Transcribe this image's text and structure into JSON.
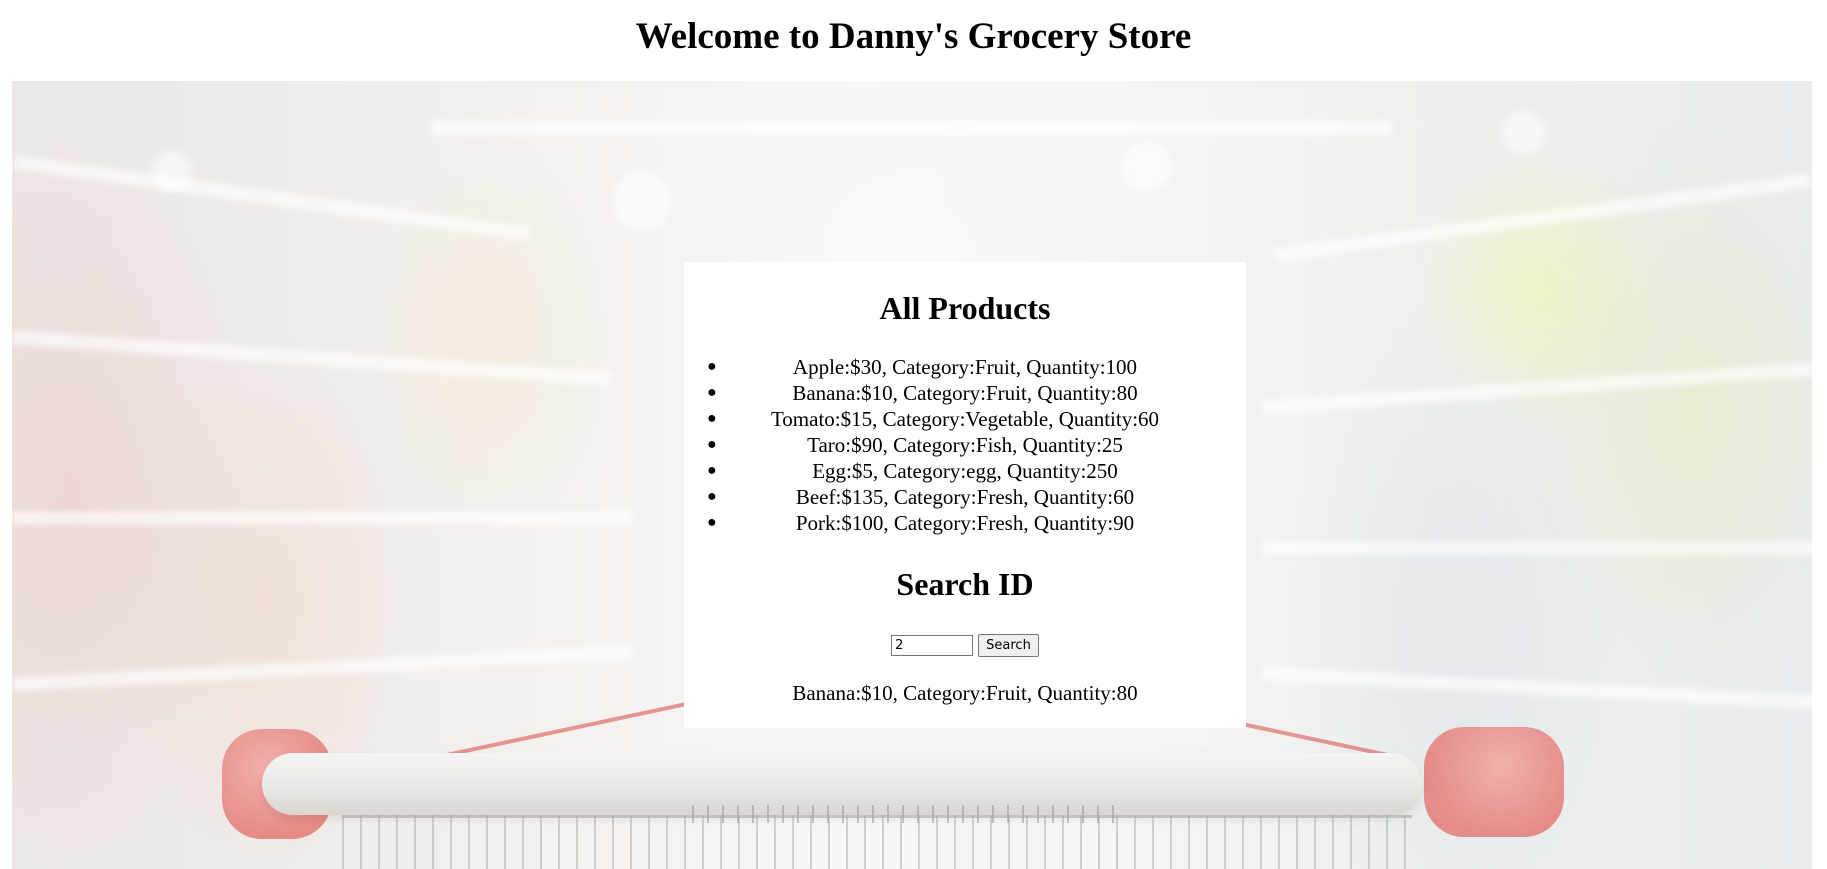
{
  "page": {
    "title": "Welcome to Danny's Grocery Store"
  },
  "products": {
    "heading": "All Products",
    "items": [
      "Apple:$30, Category:Fruit, Quantity:100",
      "Banana:$10, Category:Fruit, Quantity:80",
      "Tomato:$15, Category:Vegetable, Quantity:60",
      "Taro:$90, Category:Fish, Quantity:25",
      "Egg:$5, Category:egg, Quantity:250",
      "Beef:$135, Category:Fresh, Quantity:60",
      "Pork:$100, Category:Fresh, Quantity:90"
    ]
  },
  "search": {
    "heading": "Search ID",
    "input_value": "2",
    "button_label": "Search",
    "result": "Banana:$10, Category:Fruit, Quantity:80"
  },
  "colors": {
    "card_background": "#ffffff",
    "text": "#000000"
  }
}
